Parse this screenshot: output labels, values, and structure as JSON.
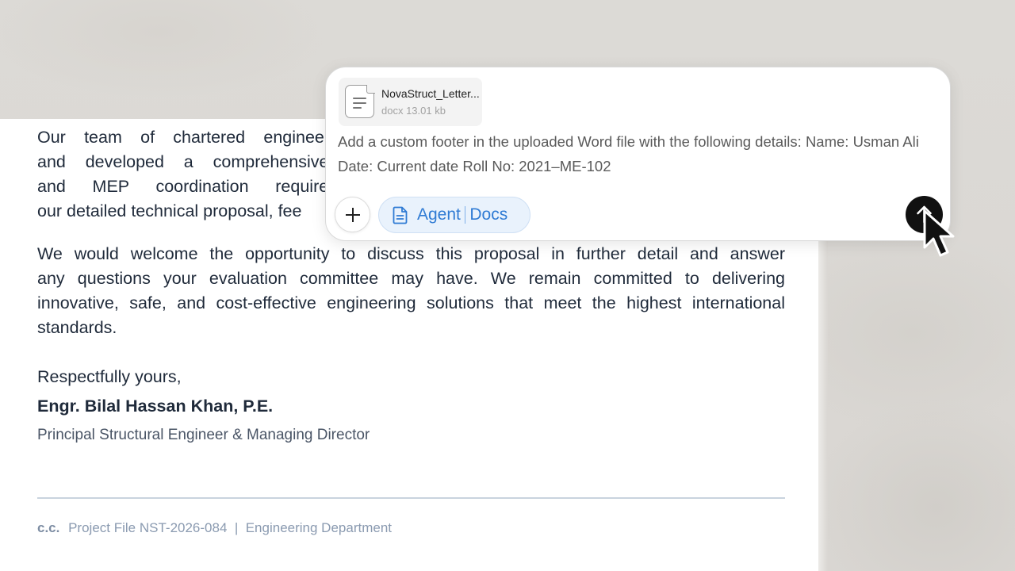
{
  "document": {
    "para1_lines": [
      "Our team of chartered engineers a",
      "and developed a comprehensive so",
      "and MEP coordination requirement",
      "our detailed technical proposal, fee"
    ],
    "para2_lines": [
      "We would welcome the opportunity to discuss this proposal in further detail and answer",
      "any questions your evaluation committee may have. We remain committed to delivering",
      "innovative, safe, and cost-effective engineering solutions that meet the highest international",
      "standards."
    ],
    "closing": "Respectfully yours,",
    "signer_name": "Engr. Bilal Hassan Khan, P.E.",
    "signer_title": "Principal Structural Engineer & Managing Director",
    "cc_label": "c.c.",
    "cc_text": "Project File NST-2026-084  |  Engineering Department"
  },
  "chat": {
    "attachment": {
      "name": "NovaStruct_Letter...",
      "meta": "docx 13.01 kb",
      "icon": "document-icon"
    },
    "prompt_text": "Add a custom footer in the uploaded Word file with the following details: Name: Usman Ali Date: Current date Roll No: 2021–ME-102",
    "agent_label": "Agent",
    "agent_mode": "Docs",
    "add_icon": "plus-icon",
    "send_icon": "arrow-up-icon"
  },
  "colors": {
    "accent": "#2f7bd4",
    "send_button": "#111111",
    "doc_text": "#1f2a3a"
  }
}
